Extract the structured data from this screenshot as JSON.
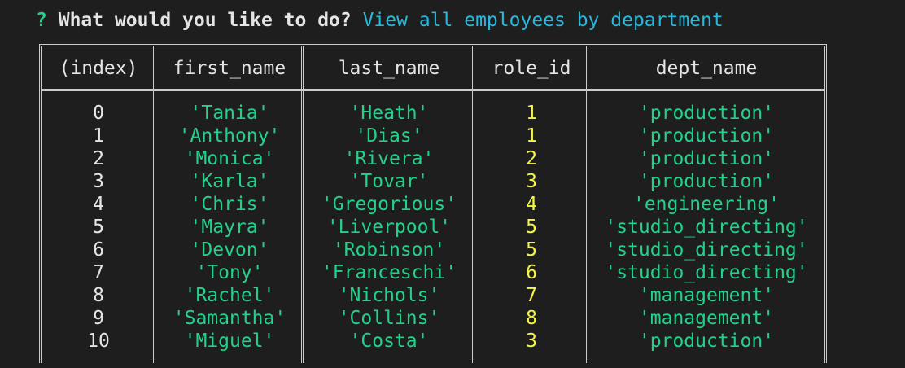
{
  "prompt": {
    "marker": "?",
    "question": "What would you like to do?",
    "answer": "View all employees by department"
  },
  "table": {
    "headers": [
      "(index)",
      "first_name",
      "last_name",
      "role_id",
      "dept_name"
    ],
    "rows": [
      {
        "index": "0",
        "first_name": "'Tania'",
        "last_name": "'Heath'",
        "role_id": "1",
        "dept_name": "'production'"
      },
      {
        "index": "1",
        "first_name": "'Anthony'",
        "last_name": "'Dias'",
        "role_id": "1",
        "dept_name": "'production'"
      },
      {
        "index": "2",
        "first_name": "'Monica'",
        "last_name": "'Rivera'",
        "role_id": "2",
        "dept_name": "'production'"
      },
      {
        "index": "3",
        "first_name": "'Karla'",
        "last_name": "'Tovar'",
        "role_id": "3",
        "dept_name": "'production'"
      },
      {
        "index": "4",
        "first_name": "'Chris'",
        "last_name": "'Gregorious'",
        "role_id": "4",
        "dept_name": "'engineering'"
      },
      {
        "index": "5",
        "first_name": "'Mayra'",
        "last_name": "'Liverpool'",
        "role_id": "5",
        "dept_name": "'studio_directing'"
      },
      {
        "index": "6",
        "first_name": "'Devon'",
        "last_name": "'Robinson'",
        "role_id": "5",
        "dept_name": "'studio_directing'"
      },
      {
        "index": "7",
        "first_name": "'Tony'",
        "last_name": "'Franceschi'",
        "role_id": "6",
        "dept_name": "'studio_directing'"
      },
      {
        "index": "8",
        "first_name": "'Rachel'",
        "last_name": "'Nichols'",
        "role_id": "7",
        "dept_name": "'management'"
      },
      {
        "index": "9",
        "first_name": "'Samantha'",
        "last_name": "'Collins'",
        "role_id": "8",
        "dept_name": "'management'"
      },
      {
        "index": "10",
        "first_name": "'Miguel'",
        "last_name": "'Costa'",
        "role_id": "3",
        "dept_name": "'production'"
      }
    ]
  },
  "colors": {
    "background": "#1e1e1e",
    "prompt_marker": "#23d18b",
    "answer": "#29b8db",
    "string_value": "#23d18b",
    "number_value": "#f5f543",
    "border": "#cccccc"
  }
}
